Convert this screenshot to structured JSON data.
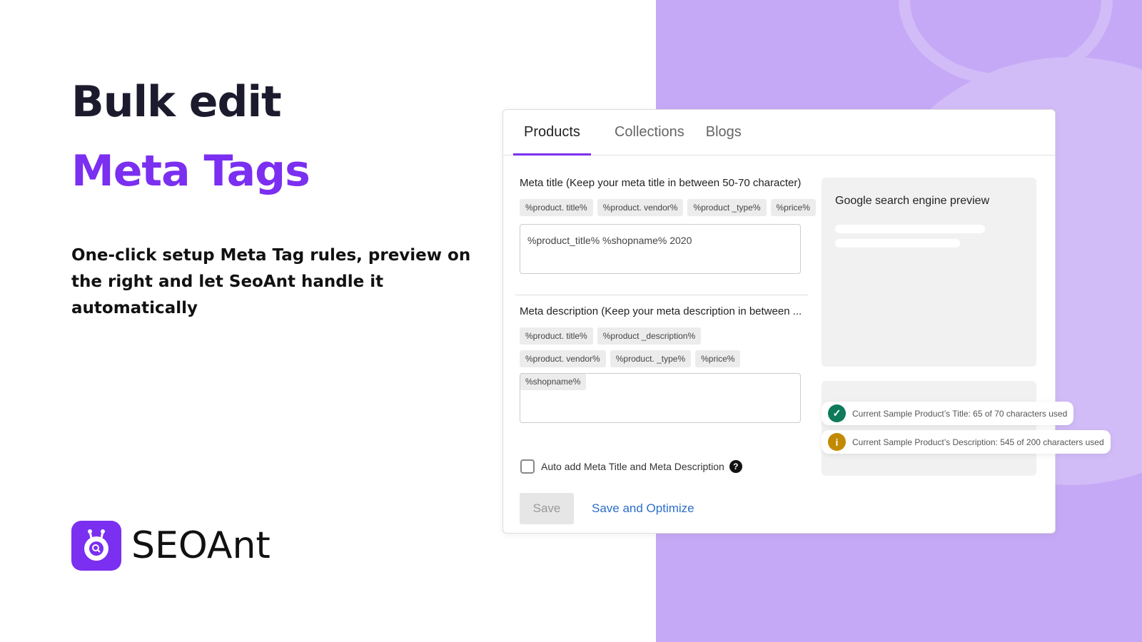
{
  "hero": {
    "title_line1": "Bulk edit",
    "title_line2": "Meta Tags",
    "subtitle": "One-click setup Meta Tag rules, preview on the right and let SeoAnt handle it automatically"
  },
  "brand": {
    "name": "SEOAnt",
    "accent": "#7b2ff0"
  },
  "tabs": [
    {
      "label": "Products",
      "active": true
    },
    {
      "label": "Collections"
    },
    {
      "label": "Blogs"
    }
  ],
  "meta_title": {
    "label": "Meta title (Keep your meta title in between 50-70 character)",
    "chips": [
      "%product. title%",
      "%product. vendor%",
      "%product _type%",
      "%price%"
    ],
    "value": "%product_title% %shopname% 2020"
  },
  "meta_description": {
    "label": "Meta description (Keep your meta description in between ...",
    "chips": [
      "%product. title%",
      "%product _description%",
      "%product. vendor%",
      "%product. _type%",
      "%price%",
      "%shopname%"
    ],
    "value": ""
  },
  "preview": {
    "title": "Google search engine preview"
  },
  "status": {
    "title_msg": "Current Sample Product’s Title: 65 of 70 characters used",
    "title_icon": "check-icon",
    "title_color": "#0e7a5a",
    "desc_msg": "Current Sample Product’s Description: 545 of 200 characters used",
    "desc_icon": "info-icon",
    "desc_color": "#c28a00"
  },
  "auto_add": {
    "label": "Auto add Meta Title and Meta Description",
    "checked": false
  },
  "buttons": {
    "save": "Save",
    "save_optimize": "Save and Optimize"
  }
}
